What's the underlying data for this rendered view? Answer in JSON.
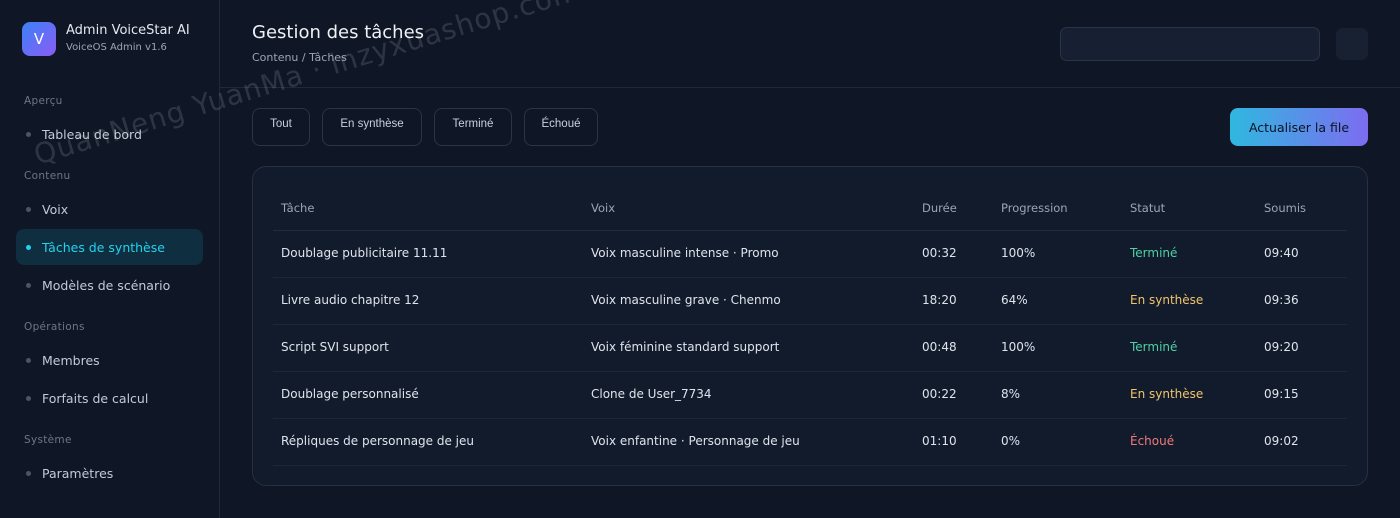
{
  "brand": {
    "logo_letter": "V",
    "name": "Admin VoiceStar AI",
    "version": "VoiceOS Admin v1.6"
  },
  "sidebar": {
    "sections": [
      {
        "title": "Aperçu",
        "items": [
          {
            "label": "Tableau de bord"
          }
        ]
      },
      {
        "title": "Contenu",
        "items": [
          {
            "label": "Voix"
          },
          {
            "label": "Tâches de synthèse",
            "active": true
          },
          {
            "label": "Modèles de scénario"
          }
        ]
      },
      {
        "title": "Opérations",
        "items": [
          {
            "label": "Membres"
          },
          {
            "label": "Forfaits de calcul"
          }
        ]
      },
      {
        "title": "Système",
        "items": [
          {
            "label": "Paramètres"
          }
        ]
      }
    ]
  },
  "header": {
    "title": "Gestion des tâches",
    "breadcrumb": "Contenu / Tâches",
    "search_placeholder": ""
  },
  "filters": [
    "Tout",
    "En synthèse",
    "Terminé",
    "Échoué"
  ],
  "refresh_label": "Actualiser la file",
  "table": {
    "columns": [
      "Tâche",
      "Voix",
      "Durée",
      "Progression",
      "Statut",
      "Soumis"
    ],
    "rows": [
      {
        "task": "Doublage publicitaire 11.11",
        "voice": "Voix masculine intense · Promo",
        "duration": "00:32",
        "progress": "100%",
        "status": "Terminé",
        "status_type": "done",
        "submitted": "09:40"
      },
      {
        "task": "Livre audio chapitre 12",
        "voice": "Voix masculine grave · Chenmo",
        "duration": "18:20",
        "progress": "64%",
        "status": "En synthèse",
        "status_type": "run",
        "submitted": "09:36"
      },
      {
        "task": "Script SVI support",
        "voice": "Voix féminine standard support",
        "duration": "00:48",
        "progress": "100%",
        "status": "Terminé",
        "status_type": "done",
        "submitted": "09:20"
      },
      {
        "task": "Doublage personnalisé",
        "voice": "Clone de User_7734",
        "duration": "00:22",
        "progress": "8%",
        "status": "En synthèse",
        "status_type": "run",
        "submitted": "09:15"
      },
      {
        "task": "Répliques de personnage de jeu",
        "voice": "Voix enfantine · Personnage de jeu",
        "duration": "01:10",
        "progress": "0%",
        "status": "Échoué",
        "status_type": "fail",
        "submitted": "09:02"
      }
    ]
  },
  "watermark": "QuanNeng YuanMa · inzyxuashop.com",
  "colors": {
    "accent": "#22d3ee",
    "done": "#4fd1a5",
    "running": "#f2c46d",
    "failed": "#f07a7a"
  }
}
